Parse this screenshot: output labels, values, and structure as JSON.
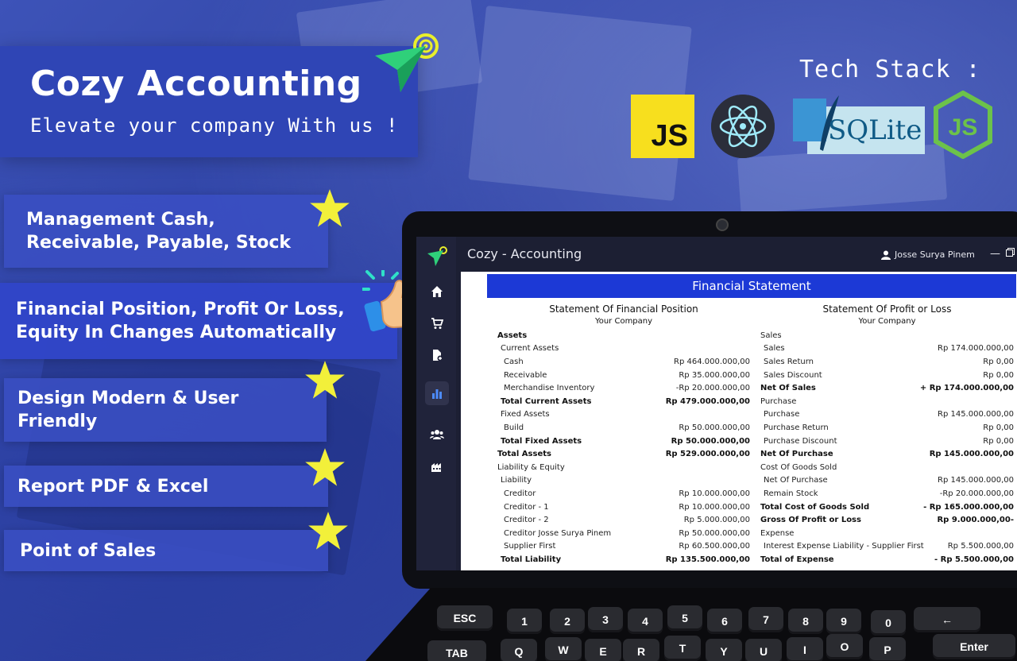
{
  "hero": {
    "title": "Cozy Accounting",
    "tagline": "Elevate your company With us !"
  },
  "tech_stack": {
    "title": "Tech Stack :",
    "logos": [
      {
        "name": "javascript",
        "text": "JS"
      },
      {
        "name": "electron"
      },
      {
        "name": "sqlite",
        "text": "SQLite"
      },
      {
        "name": "nodejs",
        "text": "JS"
      }
    ]
  },
  "features": [
    {
      "label": "Management Cash,\nReceivable, Payable, Stock"
    },
    {
      "label": "Financial Position, Profit Or Loss,\nEquity In Changes Automatically"
    },
    {
      "label": "Design Modern & User\nFriendly"
    },
    {
      "label": "Report PDF  &  Excel"
    },
    {
      "label": "Point of Sales"
    }
  ],
  "app": {
    "title": "Cozy - Accounting",
    "user": "Josse Surya Pinem",
    "sidebar_icons": [
      "logo-icon",
      "home-icon",
      "cart-icon",
      "file-add-icon",
      "chart-icon",
      "users-icon",
      "building-icon"
    ],
    "header": "Financial Statement",
    "position": {
      "title": "Statement Of Financial Position",
      "company": "Your Company",
      "rows": [
        {
          "label": "Assets",
          "value": "",
          "bold": true,
          "indent": 0
        },
        {
          "label": "Current Assets",
          "value": "",
          "bold": false,
          "indent": 1
        },
        {
          "label": "Cash",
          "value": "Rp 464.000.000,00",
          "bold": false,
          "indent": 2
        },
        {
          "label": "Receivable",
          "value": "Rp 35.000.000,00",
          "bold": false,
          "indent": 2
        },
        {
          "label": "Merchandise Inventory",
          "value": "-Rp 20.000.000,00",
          "bold": false,
          "indent": 2
        },
        {
          "label": "Total Current Assets",
          "value": "Rp 479.000.000,00",
          "bold": true,
          "indent": 1
        },
        {
          "label": "Fixed Assets",
          "value": "",
          "bold": false,
          "indent": 1
        },
        {
          "label": "Build",
          "value": "Rp 50.000.000,00",
          "bold": false,
          "indent": 2
        },
        {
          "label": "Total Fixed Assets",
          "value": "Rp 50.000.000,00",
          "bold": true,
          "indent": 1
        },
        {
          "label": "Total Assets",
          "value": "Rp 529.000.000,00",
          "bold": true,
          "indent": 0
        },
        {
          "label": "Liability & Equity",
          "value": "",
          "bold": false,
          "indent": 0
        },
        {
          "label": "Liability",
          "value": "",
          "bold": false,
          "indent": 1
        },
        {
          "label": "Creditor",
          "value": "Rp 10.000.000,00",
          "bold": false,
          "indent": 2
        },
        {
          "label": "Creditor - 1",
          "value": "Rp 10.000.000,00",
          "bold": false,
          "indent": 2
        },
        {
          "label": "Creditor - 2",
          "value": "Rp 5.000.000,00",
          "bold": false,
          "indent": 2
        },
        {
          "label": "Creditor Josse Surya Pinem",
          "value": "Rp 50.000.000,00",
          "bold": false,
          "indent": 2
        },
        {
          "label": "Supplier First",
          "value": "Rp 60.500.000,00",
          "bold": false,
          "indent": 2
        },
        {
          "label": "Total Liability",
          "value": "Rp 135.500.000,00",
          "bold": true,
          "indent": 1
        }
      ]
    },
    "profit_loss": {
      "title": "Statement Of Profit or Loss",
      "company": "Your Company",
      "rows": [
        {
          "label": "Sales",
          "value": "",
          "bold": false,
          "indent": 0
        },
        {
          "label": "Sales",
          "value": "Rp 174.000.000,00",
          "bold": false,
          "indent": 1
        },
        {
          "label": "Sales Return",
          "value": "Rp 0,00",
          "bold": false,
          "indent": 1
        },
        {
          "label": "Sales Discount",
          "value": "Rp 0,00",
          "bold": false,
          "indent": 1
        },
        {
          "label": "Net Of Sales",
          "value": "+ Rp 174.000.000,00",
          "bold": true,
          "indent": 0
        },
        {
          "label": "Purchase",
          "value": "",
          "bold": false,
          "indent": 0
        },
        {
          "label": "Purchase",
          "value": "Rp 145.000.000,00",
          "bold": false,
          "indent": 1
        },
        {
          "label": "Purchase Return",
          "value": "Rp 0,00",
          "bold": false,
          "indent": 1
        },
        {
          "label": "Purchase Discount",
          "value": "Rp 0,00",
          "bold": false,
          "indent": 1
        },
        {
          "label": "Net Of Purchase",
          "value": "Rp 145.000.000,00",
          "bold": true,
          "indent": 0
        },
        {
          "label": "Cost Of Goods Sold",
          "value": "",
          "bold": false,
          "indent": 0
        },
        {
          "label": "Net Of Purchase",
          "value": "Rp 145.000.000,00",
          "bold": false,
          "indent": 1
        },
        {
          "label": "Remain Stock",
          "value": "-Rp 20.000.000,00",
          "bold": false,
          "indent": 1
        },
        {
          "label": "Total Cost of Goods Sold",
          "value": "- Rp 165.000.000,00",
          "bold": true,
          "indent": 0
        },
        {
          "label": "Gross Of Profit or Loss",
          "value": "Rp 9.000.000,00-",
          "bold": true,
          "indent": 0
        },
        {
          "label": "Expense",
          "value": "",
          "bold": false,
          "indent": 0
        },
        {
          "label": "Interest Expense Liability - Supplier First",
          "value": "Rp 5.500.000,00",
          "bold": false,
          "indent": 1
        },
        {
          "label": "Total of Expense",
          "value": "- Rp 5.500.000,00",
          "bold": true,
          "indent": 0
        }
      ]
    }
  },
  "keyboard": {
    "row1": [
      "ESC",
      "1",
      "2",
      "3",
      "4",
      "5",
      "6",
      "7",
      "8",
      "9",
      "0",
      "←"
    ],
    "row2": [
      "TAB",
      "Q",
      "W",
      "E",
      "R",
      "T",
      "Y",
      "U",
      "I",
      "O",
      "P",
      "Enter"
    ]
  }
}
